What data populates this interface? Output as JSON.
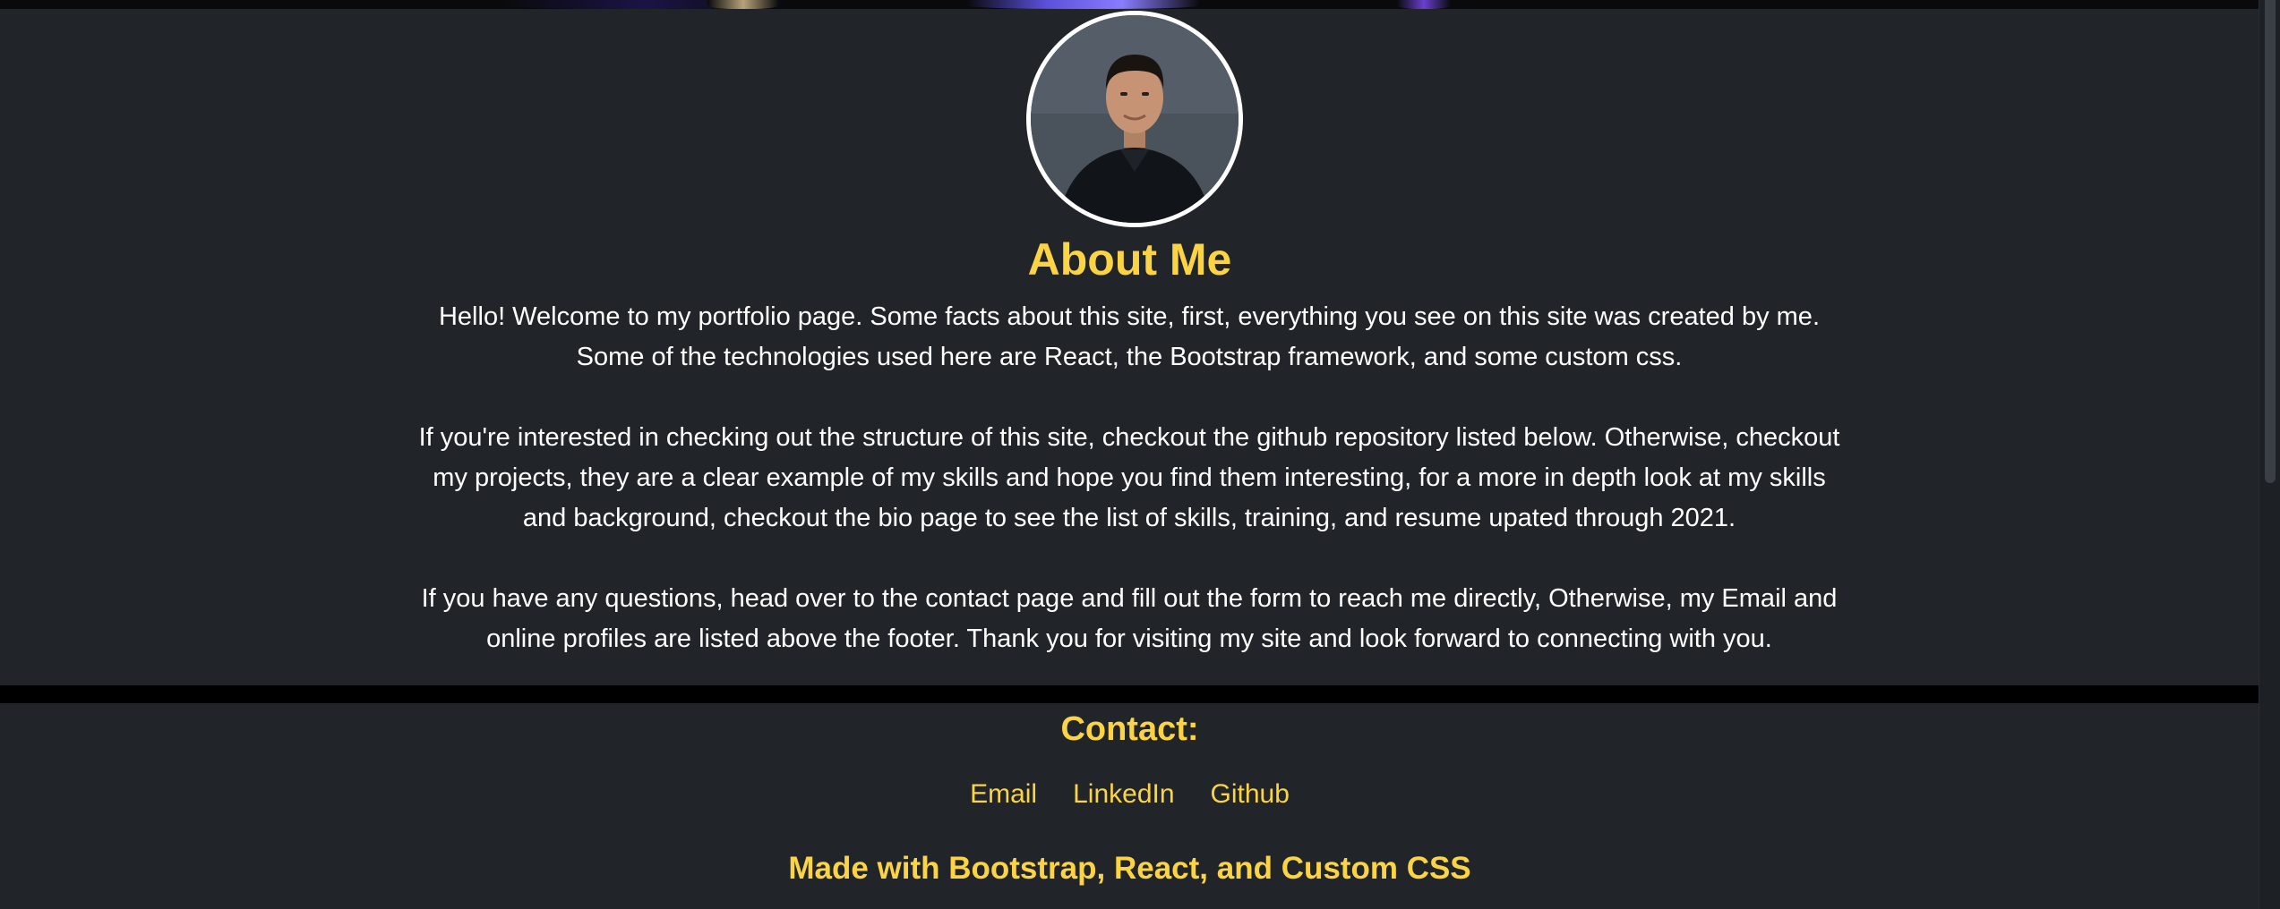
{
  "about": {
    "title": "About Me",
    "paragraphs": [
      "Hello! Welcome to my portfolio page. Some facts about this site, first, everything you see on this site was created by me. Some of the technologies used here are React, the Bootstrap framework, and some custom css.",
      "If you're interested in checking out the structure of this site, checkout the github repository listed below. Otherwise, checkout my projects, they are a clear example of my skills and hope you find them interesting, for a more in depth look at my skills and background, checkout the bio page to see the list of skills, training, and resume upated through 2021.",
      "If you have any questions, head over to the contact page and fill out the form to reach me directly, Otherwise, my Email and online profiles are listed above the footer. Thank you for visiting my site and look forward to connecting with you."
    ]
  },
  "footer": {
    "contact_title": "Contact:",
    "links": [
      "Email",
      "LinkedIn",
      "Github"
    ],
    "made_with": "Made with Bootstrap, React, and Custom CSS"
  },
  "colors": {
    "background": "#212529",
    "accent": "#fbd446",
    "text": "#ffffff",
    "divider": "#000000"
  }
}
